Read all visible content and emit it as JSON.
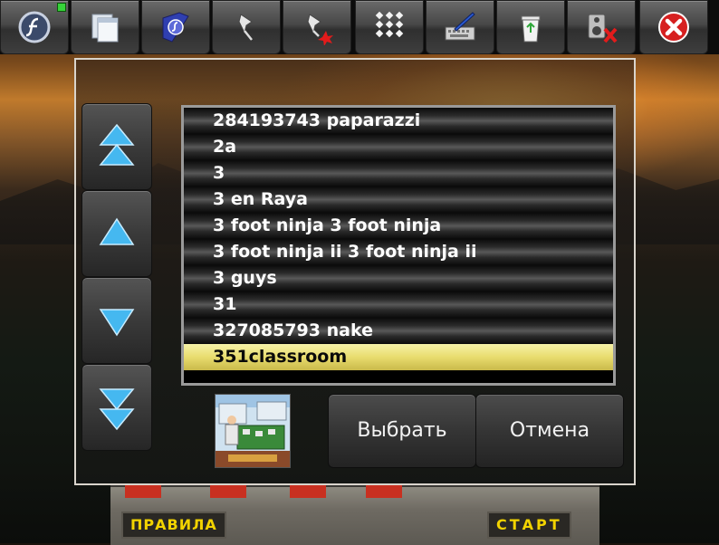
{
  "toolbar": {
    "buttons": [
      {
        "icon": "flash-player-icon"
      },
      {
        "icon": "windows-icon"
      },
      {
        "icon": "flash-book-icon"
      },
      {
        "icon": "pin-icon"
      },
      {
        "icon": "pin-remove-icon"
      },
      {
        "icon": "grid-dots-icon"
      },
      {
        "icon": "keyboard-pen-icon"
      },
      {
        "icon": "recycle-bin-icon"
      },
      {
        "icon": "speaker-mute-icon"
      },
      {
        "icon": "close-icon"
      }
    ],
    "status_led_color": "#37d23a"
  },
  "list": {
    "items": [
      "284193743 paparazzi",
      "2a",
      "3",
      "3 en Raya",
      "3 foot ninja 3 foot ninja",
      "3 foot ninja ii 3 foot ninja ii",
      "3 guys",
      "31",
      "327085793 nake",
      "351classroom"
    ],
    "selected_index": 9,
    "selected_color": "#e8dc6e"
  },
  "dialog": {
    "select_label": "Выбрать",
    "cancel_label": "Отмена"
  },
  "background_game": {
    "rules_label": "ПРАВИЛА",
    "start_label": "СТАРТ"
  }
}
